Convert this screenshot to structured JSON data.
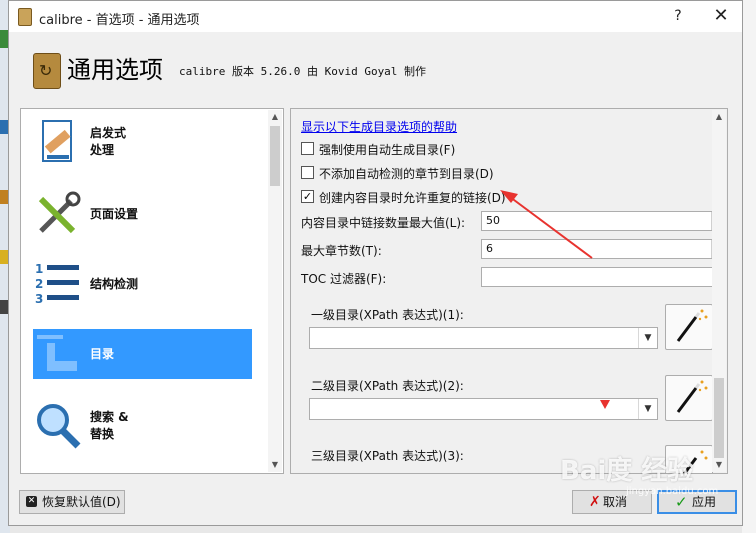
{
  "window": {
    "title": "calibre - 首选项 - 通用选项"
  },
  "header": {
    "title": "通用选项",
    "subtitle": "calibre 版本 5.26.0 由 Kovid Goyal 制作"
  },
  "nav": {
    "items": [
      {
        "label_line1": "启发式",
        "label_line2": "处理",
        "icon": "book-bandage-icon",
        "selected": false
      },
      {
        "label_line1": "页面设置",
        "label_line2": "",
        "icon": "tools-icon",
        "selected": false
      },
      {
        "label_line1": "结构检测",
        "label_line2": "",
        "icon": "numbered-list-icon",
        "selected": false
      },
      {
        "label_line1": "目录",
        "label_line2": "",
        "icon": "toc-icon",
        "selected": true
      },
      {
        "label_line1": "搜索 &",
        "label_line2": "替换",
        "icon": "magnifier-icon",
        "selected": false
      }
    ]
  },
  "panel": {
    "help_link": "显示以下生成目录选项的帮助",
    "checkboxes": [
      {
        "label": "强制使用自动生成目录(F)",
        "checked": false
      },
      {
        "label": "不添加自动检测的章节到目录(D)",
        "checked": false
      },
      {
        "label": "创建内容目录时允许重复的链接(D)",
        "checked": true
      }
    ],
    "max_links": {
      "label": "内容目录中链接数量最大值(L):",
      "value": "50"
    },
    "max_chapters": {
      "label": "最大章节数(T):",
      "value": "6"
    },
    "toc_filter": {
      "label": "TOC 过滤器(F):",
      "value": ""
    },
    "levels": [
      {
        "label": "一级目录(XPath 表达式)(1):",
        "value": ""
      },
      {
        "label": "二级目录(XPath 表达式)(2):",
        "value": ""
      },
      {
        "label": "三级目录(XPath 表达式)(3):",
        "value": ""
      }
    ]
  },
  "buttons": {
    "restore": "恢复默认值(D)",
    "cancel": "取消",
    "apply": "应用"
  },
  "watermark": {
    "text": "Bai度 经验",
    "sub": "jingyan.baidu.com"
  },
  "colors": {
    "selection": "#3399ff",
    "link": "#0000ee",
    "annotation": "#e8332f"
  }
}
